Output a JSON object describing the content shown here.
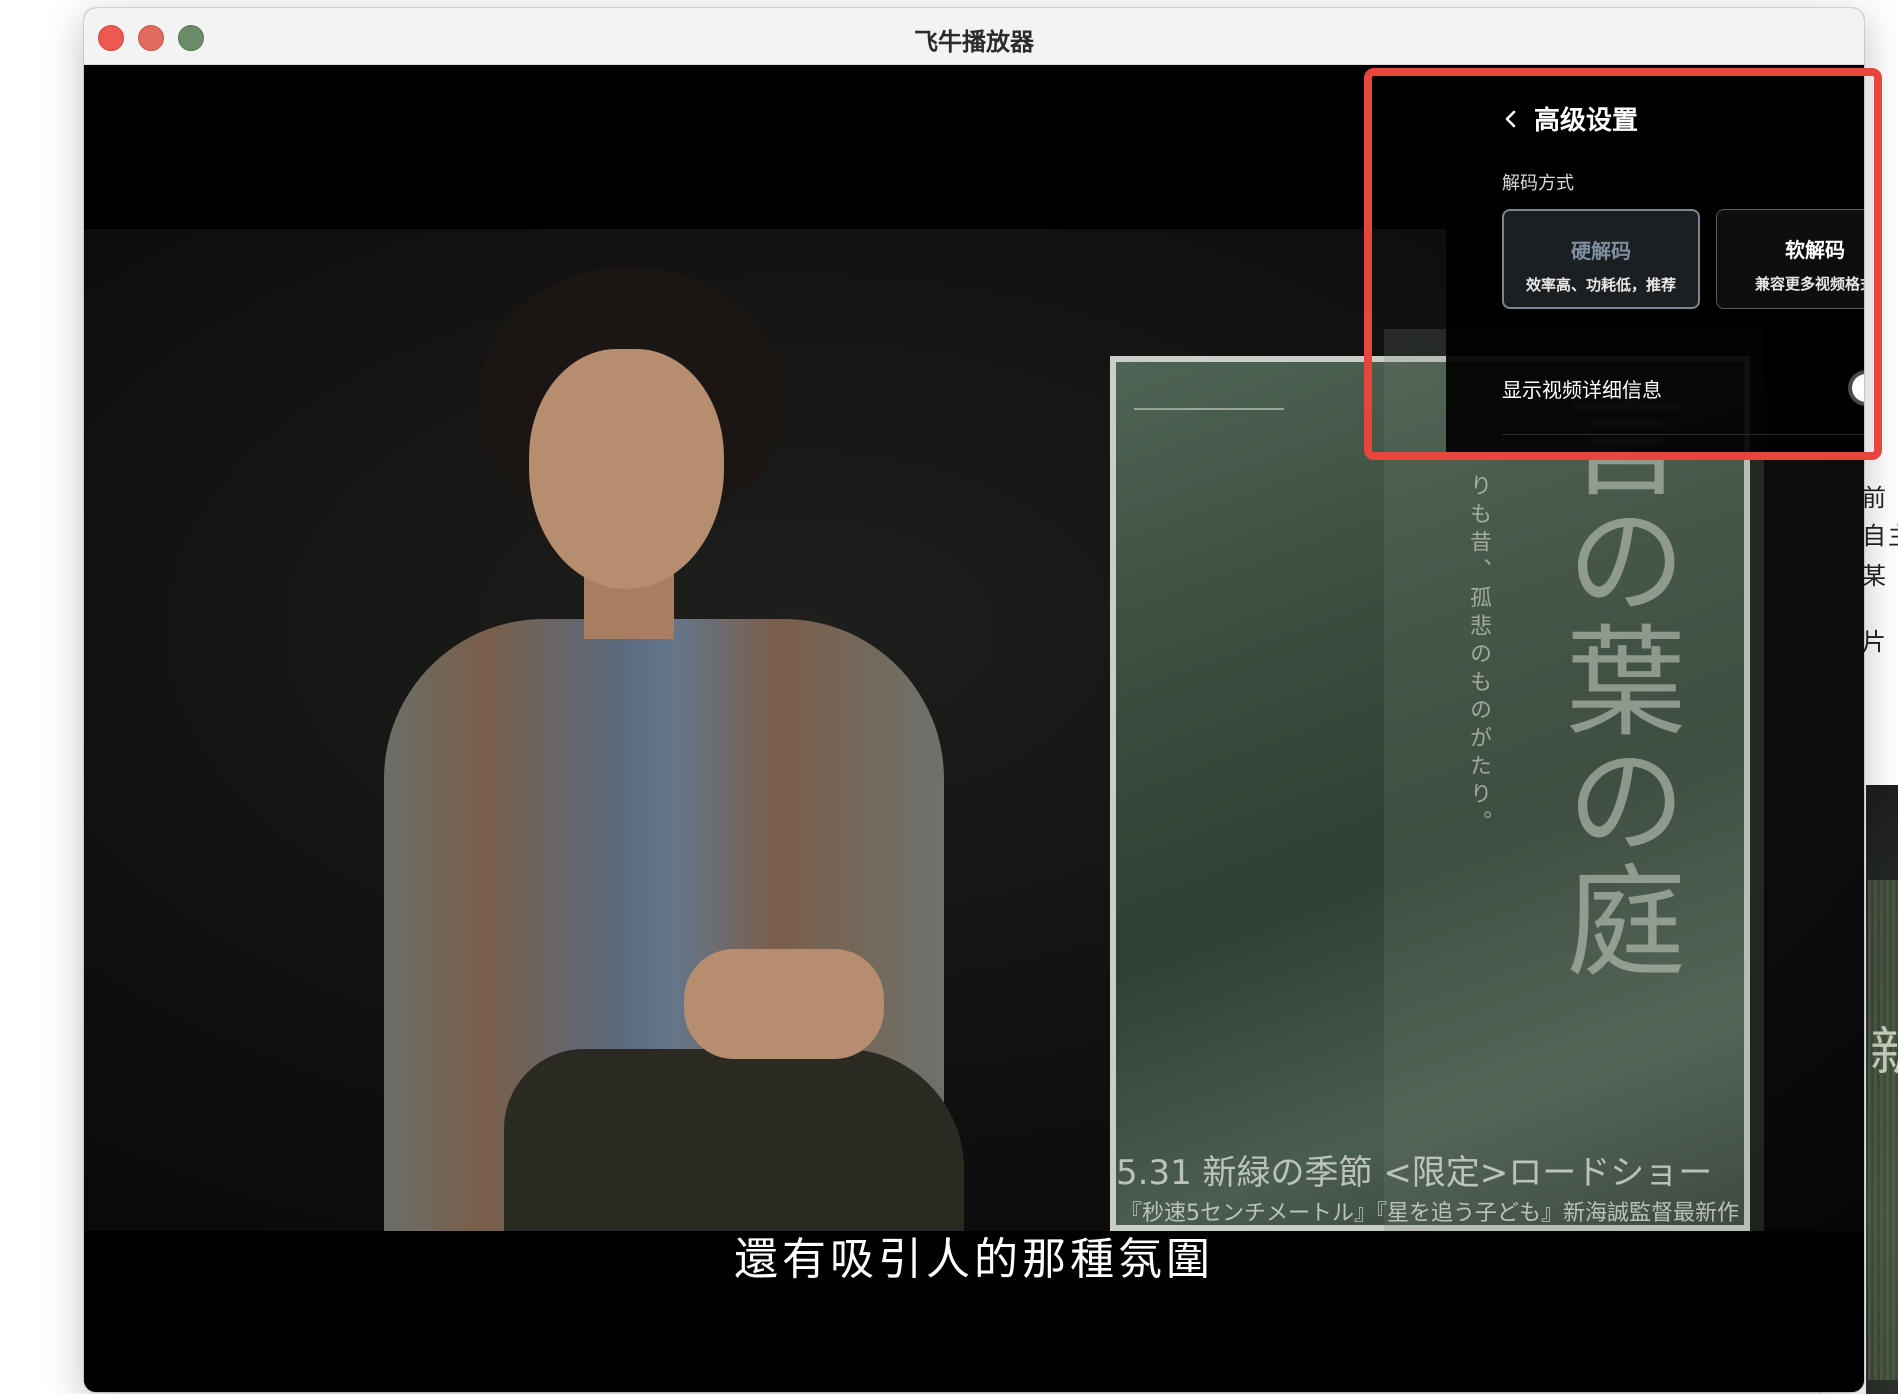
{
  "window": {
    "title": "飞牛播放器"
  },
  "background_window": {
    "text_lines": [
      "前",
      "自主",
      "某",
      "片"
    ],
    "thumb_char": "新"
  },
  "video": {
    "subtitle": "還有吸引人的那種氛圍",
    "poster": {
      "title": "言の葉の庭",
      "side_text": "りも昔、孤悲のものがたり。",
      "date_line": "5.31 新緑の季節 <限定>ロードショー",
      "bottom_line": "『秒速5センチメートル』『星を追う子ども』新海誠監督最新作"
    }
  },
  "settings_panel": {
    "title": "高级设置",
    "decode_section_label": "解码方式",
    "decode_options": [
      {
        "title": "硬解码",
        "description": "效率高、功耗低，推荐",
        "selected": true
      },
      {
        "title": "软解码",
        "description": "兼容更多视频格式",
        "selected": false
      }
    ],
    "show_details_label": "显示视频详细信息",
    "show_details_enabled": false
  },
  "colors": {
    "highlight": "#e8463c",
    "selected_option_text": "#7e8d9e",
    "toggle_off": "#4a4a4a"
  }
}
